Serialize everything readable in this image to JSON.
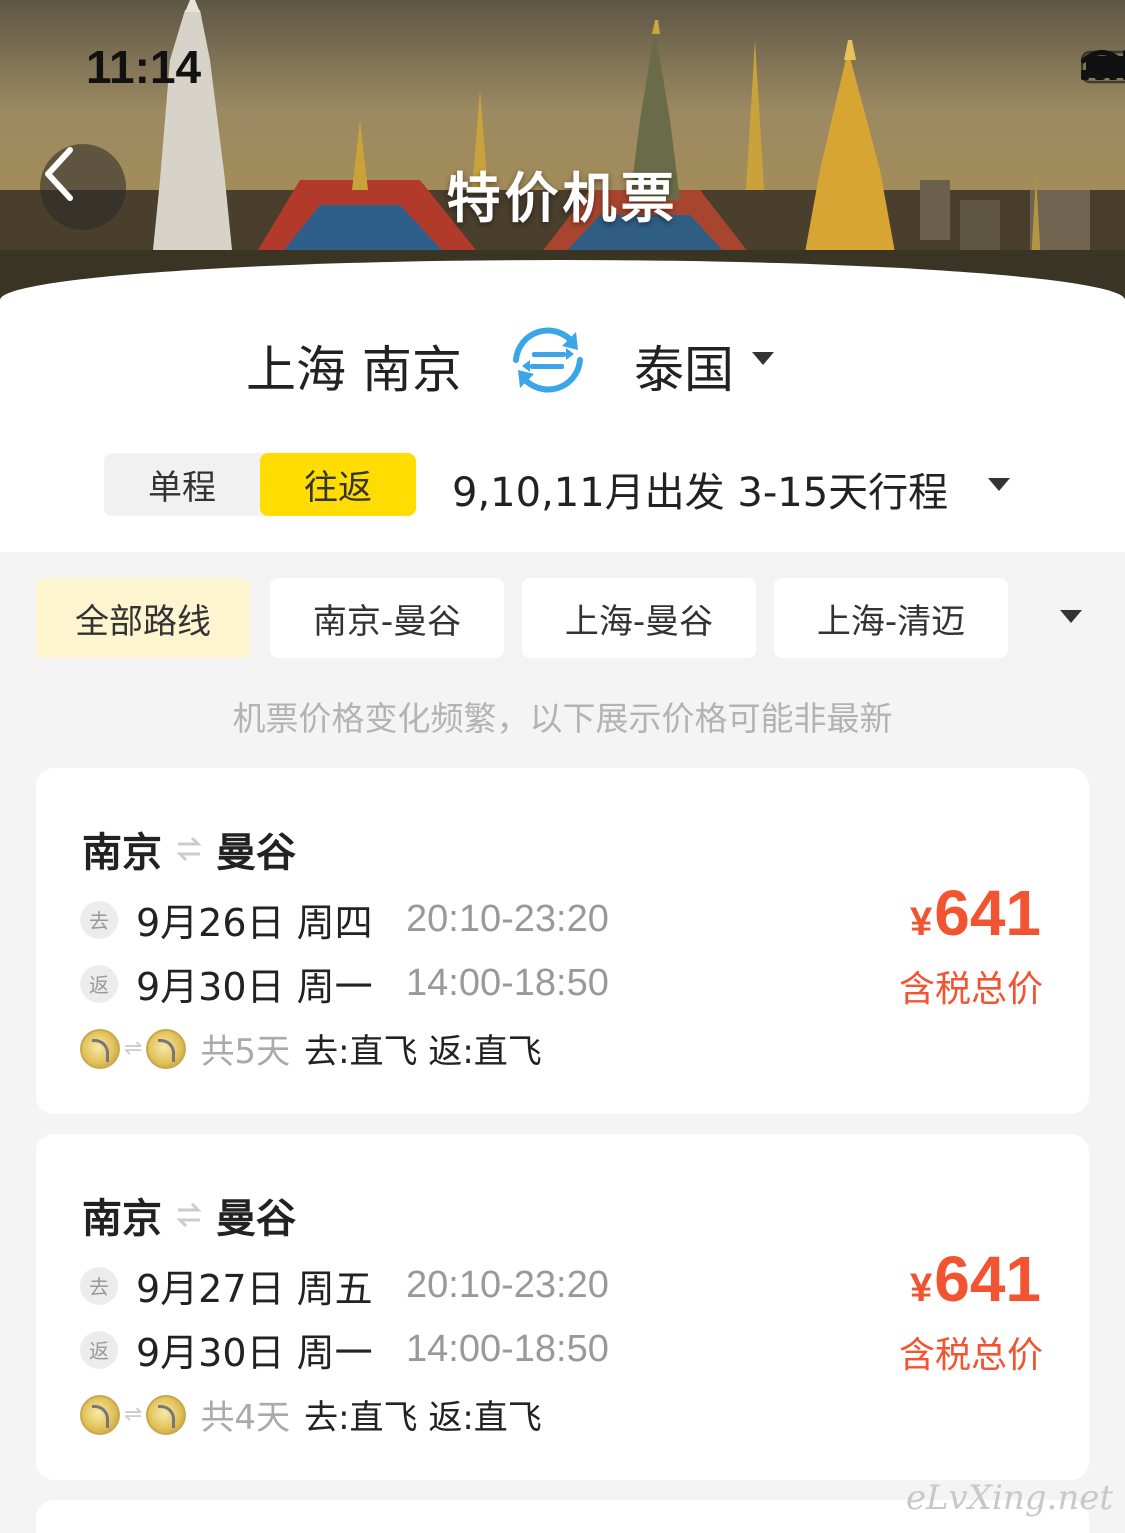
{
  "status_bar": {
    "time": "11:14"
  },
  "header": {
    "title": "特价机票"
  },
  "search": {
    "from": "上海 南京",
    "to": "泰国",
    "trip_types": [
      "单程",
      "往返"
    ],
    "active_trip_type": "往返",
    "date_filter": "9,10,11月出发 3-15天行程"
  },
  "routes": {
    "chips": [
      "全部路线",
      "南京-曼谷",
      "上海-曼谷",
      "上海-清迈"
    ],
    "active": "全部路线"
  },
  "notice": "机票价格变化频繁，以下展示价格可能非最新",
  "deals": [
    {
      "from": "南京",
      "to": "曼谷",
      "outbound_tag": "去",
      "outbound_date": "9月26日 周四",
      "outbound_time": "20:10-23:20",
      "return_tag": "返",
      "return_date": "9月30日 周一",
      "return_time": "14:00-18:50",
      "duration": "共5天",
      "flight_type": "去:直飞 返:直飞",
      "currency": "¥",
      "price": "641",
      "price_label": "含税总价"
    },
    {
      "from": "南京",
      "to": "曼谷",
      "outbound_tag": "去",
      "outbound_date": "9月27日 周五",
      "outbound_time": "20:10-23:20",
      "return_tag": "返",
      "return_date": "9月30日 周一",
      "return_time": "14:00-18:50",
      "duration": "共4天",
      "flight_type": "去:直飞 返:直飞",
      "currency": "¥",
      "price": "641",
      "price_label": "含税总价"
    }
  ],
  "watermark": "eLvXing.net",
  "colors": {
    "accent": "#ffdd00",
    "price": "#f25432",
    "chip_active": "#fdf5cf"
  },
  "icons": [
    "back-arrow-icon",
    "swap-icon",
    "caret-down-icon",
    "signal-icon",
    "wifi-icon",
    "battery-icon",
    "airline-logo"
  ]
}
